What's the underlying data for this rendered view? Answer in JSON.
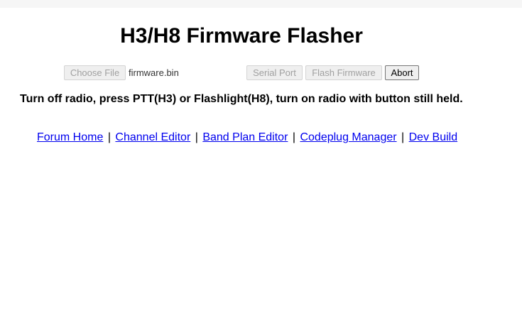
{
  "page": {
    "title": "H3/H8 Firmware Flasher"
  },
  "controls": {
    "choose_file_label": "Choose File",
    "file_name": "firmware.bin",
    "serial_port_label": "Serial Port",
    "flash_firmware_label": "Flash Firmware",
    "abort_label": "Abort"
  },
  "instructions": "Turn off radio, press PTT(H3) or Flashlight(H8), turn on radio with button still held.",
  "links": [
    {
      "label": "Forum Home"
    },
    {
      "label": "Channel Editor"
    },
    {
      "label": "Band Plan Editor"
    },
    {
      "label": "Codeplug Manager"
    },
    {
      "label": "Dev Build"
    }
  ],
  "link_separator": "|",
  "colors": {
    "link": "#0000ee",
    "disabled_text": "#a0a0a0",
    "top_bar": "#f6f6f6"
  }
}
